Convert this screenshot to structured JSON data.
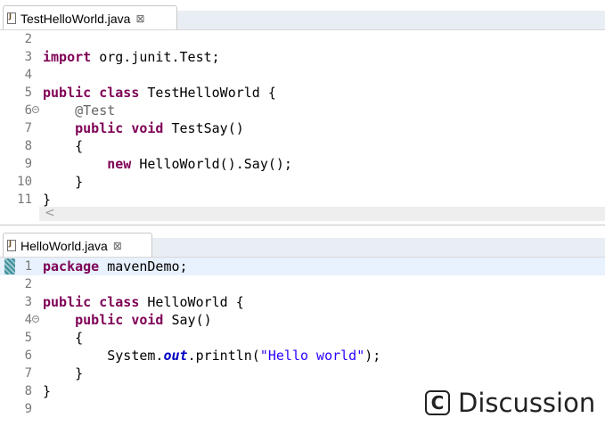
{
  "editors": [
    {
      "tab": {
        "title": "TestHelloWorld.java",
        "close_glyph": "⊠",
        "icon": "java-file-icon"
      },
      "lines": [
        {
          "n": "2",
          "html": ""
        },
        {
          "n": "3",
          "html": "<span class=\"kw\">import</span> org.junit.Test;"
        },
        {
          "n": "4",
          "html": ""
        },
        {
          "n": "5",
          "html": "<span class=\"kw\">public class</span> TestHelloWorld {"
        },
        {
          "n": "6",
          "fold": true,
          "html": "    <span class=\"an\">@Test</span>"
        },
        {
          "n": "7",
          "html": "    <span class=\"kw\">public void</span> TestSay()"
        },
        {
          "n": "8",
          "html": "    {"
        },
        {
          "n": "9",
          "html": "        <span class=\"kw\">new</span> HelloWorld().Say();"
        },
        {
          "n": "10",
          "html": "    }"
        },
        {
          "n": "11",
          "html": "}"
        }
      ],
      "scroll_left_glyph": "<"
    },
    {
      "tab": {
        "title": "HelloWorld.java",
        "close_glyph": "⊠",
        "icon": "java-file-icon"
      },
      "lines": [
        {
          "n": "1",
          "marker": true,
          "highlight": true,
          "html": "<span class=\"kw\">package</span> mavenDemo;"
        },
        {
          "n": "2",
          "html": ""
        },
        {
          "n": "3",
          "html": "<span class=\"kw\">public class</span> HelloWorld {"
        },
        {
          "n": "4",
          "fold": true,
          "html": "    <span class=\"kw\">public void</span> Say()"
        },
        {
          "n": "5",
          "html": "    {"
        },
        {
          "n": "6",
          "html": "        System.<span class=\"fd\">out</span>.println(<span class=\"st\">\"Hello world\"</span>);"
        },
        {
          "n": "7",
          "html": "    }"
        },
        {
          "n": "8",
          "html": "}"
        },
        {
          "n": "9",
          "html": ""
        }
      ]
    }
  ],
  "watermark": {
    "logo_letter": "C",
    "text": "Discussion"
  },
  "colors": {
    "keyword": "#7f0055",
    "annotation": "#646464",
    "string": "#2a00ff",
    "field": "#0000c0",
    "current_line": "#e8f2fe",
    "tab_strip": "#e9eef4"
  }
}
